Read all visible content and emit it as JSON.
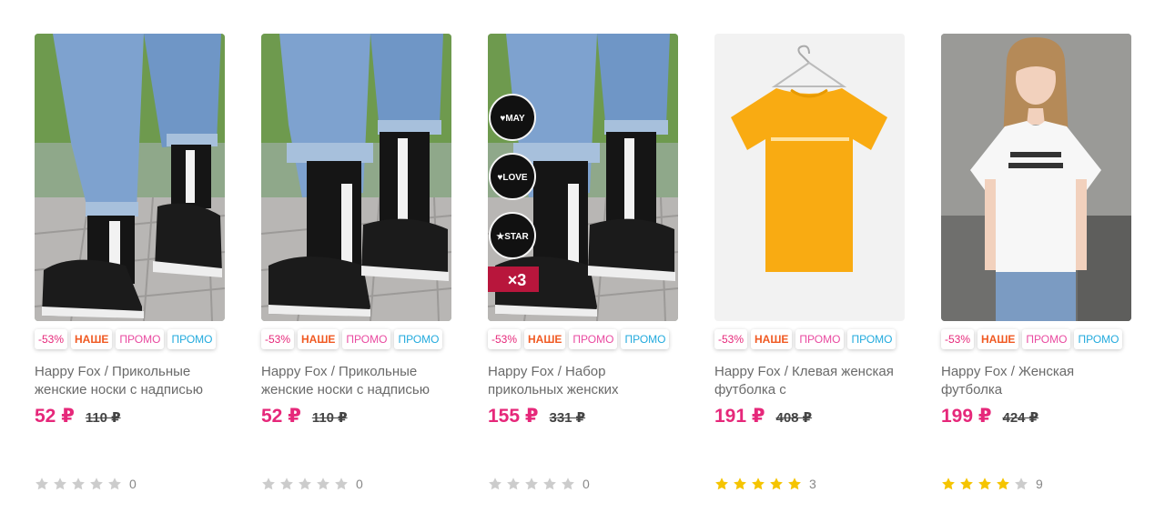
{
  "colors": {
    "price": "#e6287a",
    "star_on": "#f5c400",
    "star_off": "#cccccc"
  },
  "products": [
    {
      "image": "black-socks-on-sneakers-photo",
      "badges": {
        "discount": "-53%",
        "nashe": "НАШЕ",
        "promo1": "ПРОМО",
        "promo2": "ПРОМО"
      },
      "title": "Happy Fox / Прикольные женские носки с надписью",
      "price": "52 ₽",
      "old_price": "110 ₽",
      "rating": 0,
      "reviews": "0"
    },
    {
      "image": "black-socks-on-sneakers-photo",
      "badges": {
        "discount": "-53%",
        "nashe": "НАШЕ",
        "promo1": "ПРОМО",
        "promo2": "ПРОМО"
      },
      "title": "Happy Fox / Прикольные женские носки с надписью",
      "price": "52 ₽",
      "old_price": "110 ₽",
      "rating": 0,
      "reviews": "0"
    },
    {
      "image": "socks-set-photo",
      "badges": {
        "discount": "-53%",
        "nashe": "НАШЕ",
        "promo1": "ПРОМО",
        "promo2": "ПРОМО"
      },
      "title": "Happy Fox / Набор прикольных женских",
      "price": "155 ₽",
      "old_price": "331 ₽",
      "rating": 0,
      "reviews": "0",
      "overlay": {
        "circle1": "♥MAY",
        "circle2": "♥LOVE",
        "circle3": "★STAR",
        "pack": "×3"
      }
    },
    {
      "image": "yellow-tshirt-on-hanger-photo",
      "badges": {
        "discount": "-53%",
        "nashe": "НАШЕ",
        "promo1": "ПРОМО",
        "promo2": "ПРОМО"
      },
      "title": "Happy Fox / Клевая женская футболка с",
      "price": "191 ₽",
      "old_price": "408 ₽",
      "rating": 5,
      "reviews": "3"
    },
    {
      "image": "woman-in-white-tshirt-photo",
      "badges": {
        "discount": "-53%",
        "nashe": "НАШЕ",
        "promo1": "ПРОМО",
        "promo2": "ПРОМО"
      },
      "title": "Happy Fox / Женская футболка",
      "price": "199 ₽",
      "old_price": "424 ₽",
      "rating": 4,
      "reviews": "9"
    }
  ]
}
